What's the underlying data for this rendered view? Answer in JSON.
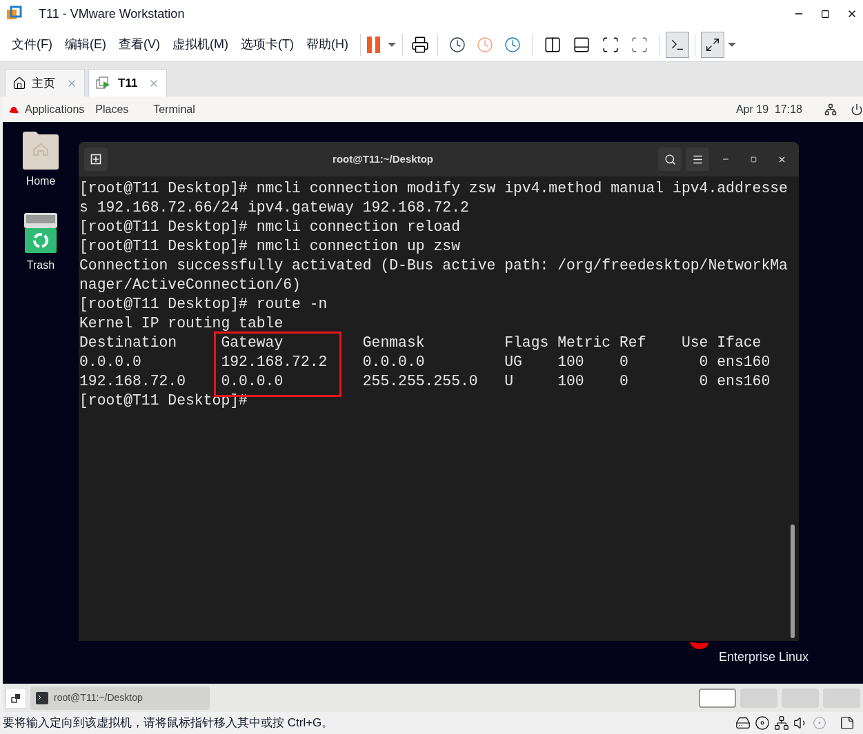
{
  "window": {
    "title": "T11 - VMware Workstation"
  },
  "menu": [
    "文件(F)",
    "编辑(E)",
    "查看(V)",
    "虚拟机(M)",
    "选项卡(T)",
    "帮助(H)"
  ],
  "tabs": [
    {
      "label": "主页",
      "kind": "home",
      "selected": false
    },
    {
      "label": "T11",
      "kind": "vm",
      "selected": true
    }
  ],
  "gnome_bar": {
    "applications": "Applications",
    "places": "Places",
    "app": "Terminal",
    "datetime": "Apr 19  17:18"
  },
  "desktop_icons": [
    {
      "label": "Home",
      "kind": "folder"
    },
    {
      "label": "Trash",
      "kind": "trash"
    }
  ],
  "terminal": {
    "title": "root@T11:~/Desktop",
    "lines": [
      "[root@T11 Desktop]# nmcli connection modify zsw ipv4.method manual ipv4.addresse",
      "s 192.168.72.66/24 ipv4.gateway 192.168.72.2",
      "[root@T11 Desktop]# nmcli connection reload",
      "[root@T11 Desktop]# nmcli connection up zsw",
      "Connection successfully activated (D-Bus active path: /org/freedesktop/NetworkMa",
      "nager/ActiveConnection/6)",
      "[root@T11 Desktop]# route -n",
      "Kernel IP routing table",
      "Destination     Gateway         Genmask         Flags Metric Ref    Use Iface",
      "0.0.0.0         192.168.72.2    0.0.0.0         UG    100    0        0 ens160",
      "192.168.72.0    0.0.0.0         255.255.255.0   U     100    0        0 ens160",
      "[root@T11 Desktop]# "
    ]
  },
  "branding": "Enterprise Linux",
  "taskbar": {
    "item": "root@T11:~/Desktop"
  },
  "workspaces": [
    {
      "selected": true
    },
    {
      "selected": false
    },
    {
      "selected": false
    },
    {
      "selected": false
    }
  ],
  "status_bar": "要将输入定向到该虚拟机，请将鼠标指针移入其中或按 Ctrl+G。"
}
